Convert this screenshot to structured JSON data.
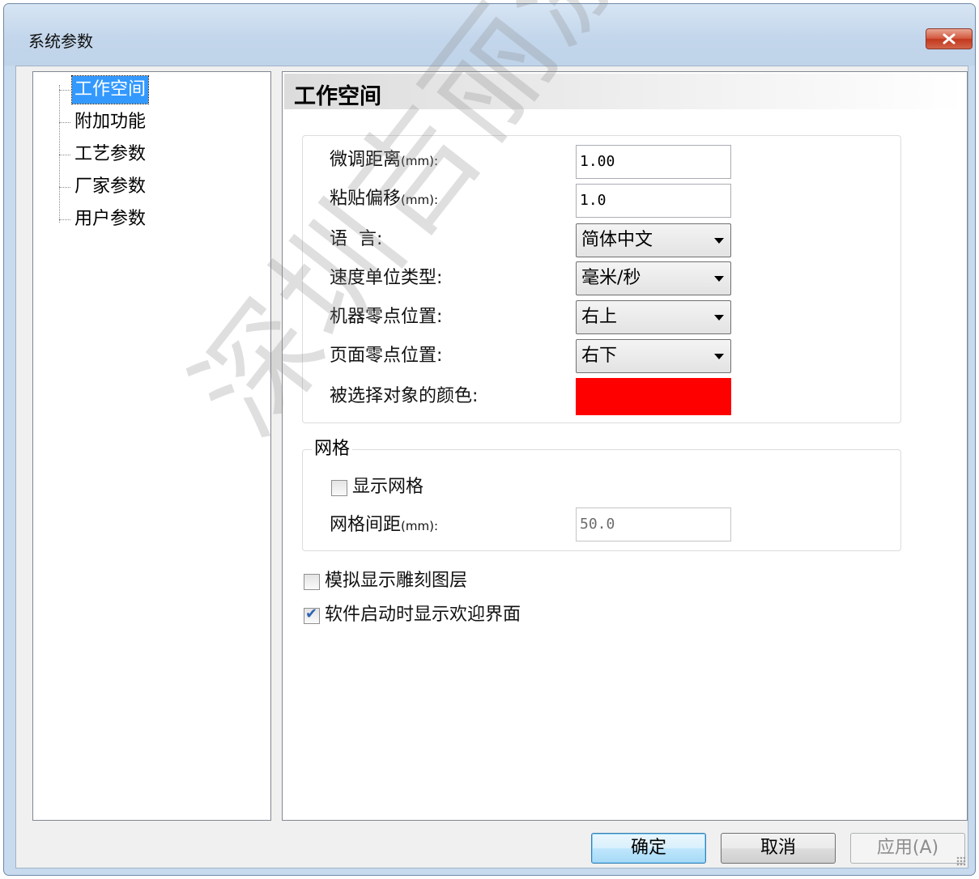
{
  "window": {
    "title": "系统参数",
    "close_icon": "close-icon"
  },
  "tree": {
    "items": [
      {
        "label": "工作空间",
        "selected": true
      },
      {
        "label": "附加功能",
        "selected": false
      },
      {
        "label": "工艺参数",
        "selected": false
      },
      {
        "label": "厂家参数",
        "selected": false
      },
      {
        "label": "用户参数",
        "selected": false
      }
    ]
  },
  "panel": {
    "title": "工作空间",
    "fine_tune": {
      "label": "微调距离",
      "unit": "(mm):",
      "value": "1.00"
    },
    "paste_offset": {
      "label": "粘贴偏移",
      "unit": "(mm):",
      "value": "1.0"
    },
    "language": {
      "label": "语  言:",
      "value": "简体中文"
    },
    "speed_unit": {
      "label": "速度单位类型:",
      "value": "毫米/秒"
    },
    "machine_zero": {
      "label": "机器零点位置:",
      "value": "右上"
    },
    "page_zero": {
      "label": "页面零点位置:",
      "value": "右下"
    },
    "selected_color": {
      "label": "被选择对象的颜色:",
      "color": "#ff0000"
    },
    "grid": {
      "legend": "网格",
      "show_grid": {
        "label": "显示网格",
        "checked": false
      },
      "spacing": {
        "label": "网格间距",
        "unit": "(mm):",
        "value": "50.0"
      }
    },
    "simulate_layers": {
      "label": "模拟显示雕刻图层",
      "checked": false
    },
    "show_welcome": {
      "label": "软件启动时显示欢迎界面",
      "checked": true
    }
  },
  "buttons": {
    "ok": "确定",
    "cancel": "取消",
    "apply": "应用(A)"
  },
  "watermark": "深圳吉丽激光版权"
}
